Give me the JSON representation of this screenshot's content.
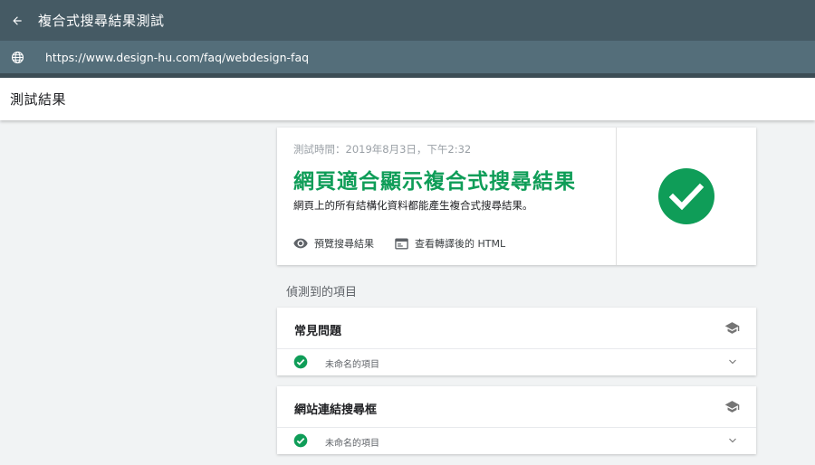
{
  "topbar": {
    "title": "複合式搜尋結果測試"
  },
  "urlbar": {
    "url": "https://www.design-hu.com/faq/webdesign-faq"
  },
  "section": {
    "title": "測試結果"
  },
  "result": {
    "test_time": "測試時間：2019年8月3日，下午2:32",
    "headline": "網頁適合顯示複合式搜尋結果",
    "subline": "網頁上的所有結構化資料都能產生複合式搜尋結果。",
    "preview_label": "預覽搜尋結果",
    "html_label": "查看轉譯後的 HTML",
    "status_color": "#0f9d58"
  },
  "detected": {
    "label": "偵測到的項目",
    "items": [
      {
        "title": "常見問題",
        "row_label": "未命名的項目"
      },
      {
        "title": "網站連結搜尋框",
        "row_label": "未命名的項目"
      }
    ]
  }
}
